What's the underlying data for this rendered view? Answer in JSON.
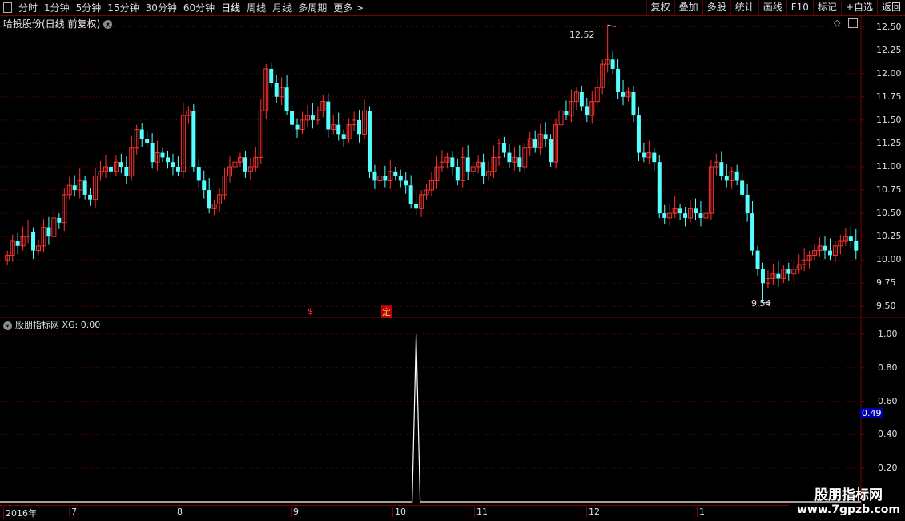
{
  "toolbar": {
    "periods": [
      "分时",
      "1分钟",
      "5分钟",
      "15分钟",
      "30分钟",
      "60分钟",
      "日线",
      "周线",
      "月线",
      "多周期",
      "更多 >"
    ],
    "active_period": "日线",
    "buttons": [
      "复权",
      "叠加",
      "多股",
      "统计",
      "画线",
      "F10",
      "标记",
      "+自选",
      "返回"
    ]
  },
  "main_chart": {
    "title": "哈投股份(日线 前复权)",
    "high_label": "12.52",
    "low_label": "9.54",
    "marker_s": "$",
    "marker_ding": "定",
    "y_ticks": [
      "12.50",
      "12.25",
      "12.00",
      "11.75",
      "11.50",
      "11.25",
      "11.00",
      "10.75",
      "10.50",
      "10.25",
      "10.00",
      "9.75",
      "9.50"
    ],
    "colors": {
      "up": "#ff3232",
      "down": "#54ffff",
      "grid": "#7a0000"
    }
  },
  "indicator": {
    "title": "股朋指标网 XG: 0.00",
    "y_ticks": [
      "1.00",
      "0.80",
      "0.60",
      "0.40",
      "0.20"
    ],
    "current_value": "0.49"
  },
  "time_axis": {
    "labels": [
      "2016年",
      "7",
      "8",
      "9",
      "10",
      "11",
      "12",
      "1"
    ]
  },
  "watermark": {
    "line1": "股朋指标网",
    "line2": "www.7gpzb.com"
  },
  "chart_data": {
    "type": "candlestick",
    "title": "哈投股份(日线 前复权)",
    "ylim": [
      9.4,
      12.6
    ],
    "y_ticks": [
      12.5,
      12.25,
      12.0,
      11.75,
      11.5,
      11.25,
      11.0,
      10.75,
      10.5,
      10.25,
      10.0,
      9.75,
      9.5
    ],
    "high_label": 12.52,
    "low_label": 9.54,
    "closes": [
      10.05,
      10.2,
      10.15,
      10.25,
      10.3,
      10.1,
      10.15,
      10.35,
      10.25,
      10.45,
      10.4,
      10.7,
      10.8,
      10.75,
      10.85,
      10.7,
      10.65,
      10.9,
      10.95,
      11.0,
      10.95,
      11.05,
      11.0,
      10.9,
      11.2,
      11.4,
      11.3,
      11.25,
      11.05,
      11.15,
      11.1,
      11.05,
      11.0,
      10.95,
      11.55,
      11.6,
      11.0,
      10.85,
      10.75,
      10.55,
      10.6,
      10.7,
      10.9,
      11.0,
      11.05,
      11.1,
      10.95,
      11.0,
      11.1,
      11.6,
      12.05,
      11.9,
      11.75,
      11.85,
      11.6,
      11.45,
      11.4,
      11.5,
      11.55,
      11.5,
      11.6,
      11.7,
      11.4,
      11.45,
      11.35,
      11.3,
      11.45,
      11.5,
      11.35,
      11.6,
      10.95,
      10.85,
      10.9,
      10.85,
      10.95,
      10.9,
      10.85,
      10.8,
      10.6,
      10.55,
      10.7,
      10.75,
      10.85,
      11.0,
      11.05,
      11.1,
      11.0,
      10.85,
      11.1,
      10.95,
      11.0,
      11.05,
      10.9,
      10.95,
      11.1,
      11.25,
      11.15,
      11.05,
      11.1,
      11.0,
      11.2,
      11.3,
      11.2,
      11.35,
      11.3,
      11.05,
      11.45,
      11.6,
      11.55,
      11.7,
      11.8,
      11.65,
      11.55,
      11.7,
      11.85,
      12.1,
      12.15,
      12.05,
      11.8,
      11.75,
      11.8,
      11.55,
      11.15,
      11.1,
      11.15,
      11.05,
      10.5,
      10.45,
      10.5,
      10.55,
      10.5,
      10.45,
      10.55,
      10.5,
      10.45,
      10.5,
      11.0,
      11.05,
      10.9,
      10.85,
      10.95,
      10.85,
      10.7,
      10.5,
      10.1,
      9.9,
      9.75,
      9.8,
      9.85,
      9.8,
      9.9,
      9.85,
      9.9,
      9.95,
      10.0,
      10.05,
      10.1,
      10.15,
      10.1,
      10.05,
      10.15,
      10.2,
      10.25,
      10.2,
      10.1
    ],
    "xg_signal_index": 79,
    "xg_ylim": [
      0,
      1.0
    ],
    "time_labels": [
      "2016年",
      "7",
      "8",
      "9",
      "10",
      "11",
      "12",
      "1"
    ]
  }
}
